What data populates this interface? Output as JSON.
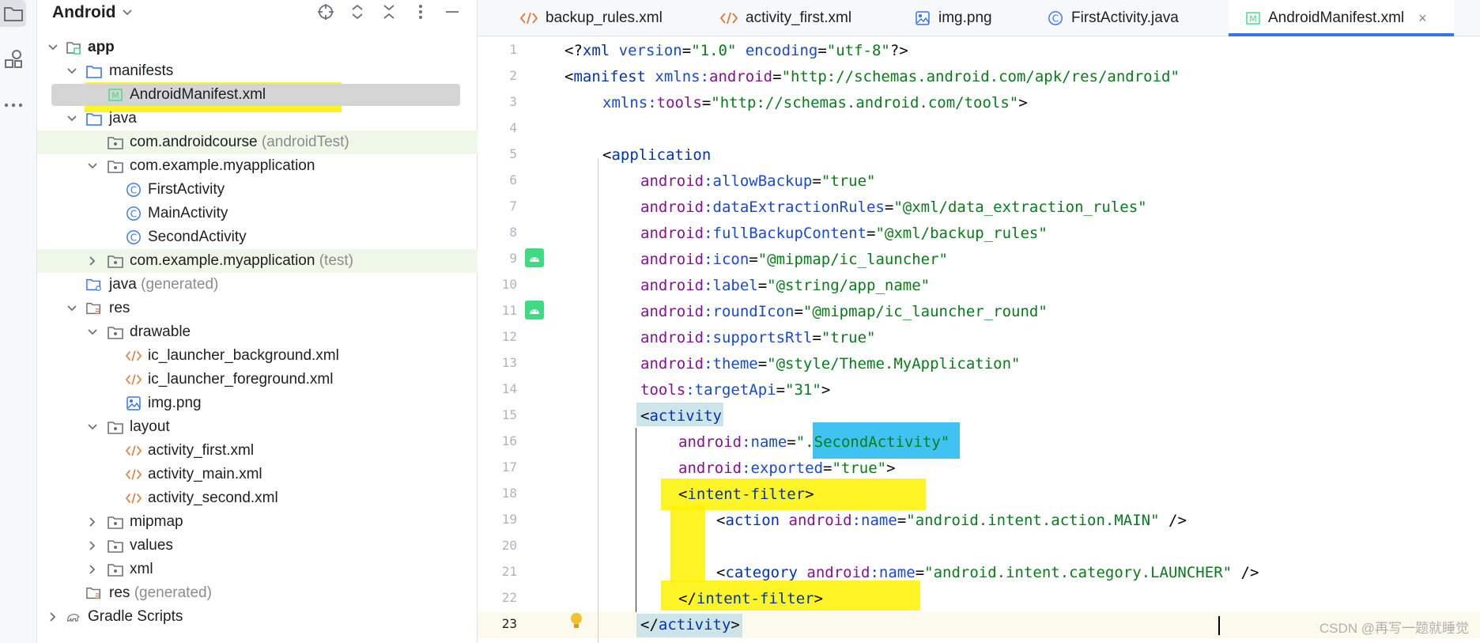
{
  "project_panel": {
    "title": "Android"
  },
  "tree": [
    {
      "label": "app",
      "suffix": "",
      "bold": true
    },
    {
      "label": "manifests",
      "suffix": ""
    },
    {
      "label": "AndroidManifest.xml",
      "suffix": ""
    },
    {
      "label": "java",
      "suffix": ""
    },
    {
      "label": "com.androidcourse",
      "suffix": "(androidTest)"
    },
    {
      "label": "com.example.myapplication",
      "suffix": ""
    },
    {
      "label": "FirstActivity",
      "suffix": ""
    },
    {
      "label": "MainActivity",
      "suffix": ""
    },
    {
      "label": "SecondActivity",
      "suffix": ""
    },
    {
      "label": "com.example.myapplication",
      "suffix": "(test)"
    },
    {
      "label": "java",
      "suffix": "(generated)"
    },
    {
      "label": "res",
      "suffix": ""
    },
    {
      "label": "drawable",
      "suffix": ""
    },
    {
      "label": "ic_launcher_background.xml",
      "suffix": ""
    },
    {
      "label": "ic_launcher_foreground.xml",
      "suffix": ""
    },
    {
      "label": "img.png",
      "suffix": ""
    },
    {
      "label": "layout",
      "suffix": ""
    },
    {
      "label": "activity_first.xml",
      "suffix": ""
    },
    {
      "label": "activity_main.xml",
      "suffix": ""
    },
    {
      "label": "activity_second.xml",
      "suffix": ""
    },
    {
      "label": "mipmap",
      "suffix": ""
    },
    {
      "label": "values",
      "suffix": ""
    },
    {
      "label": "xml",
      "suffix": ""
    },
    {
      "label": "res",
      "suffix": "(generated)"
    },
    {
      "label": "Gradle Scripts",
      "suffix": ""
    }
  ],
  "tabs": [
    {
      "label": "backup_rules.xml"
    },
    {
      "label": "activity_first.xml"
    },
    {
      "label": "img.png"
    },
    {
      "label": "FirstActivity.java"
    },
    {
      "label": "AndroidManifest.xml",
      "close": "×"
    }
  ],
  "line_numbers": [
    "1",
    "2",
    "3",
    "4",
    "5",
    "6",
    "7",
    "8",
    "9",
    "10",
    "11",
    "12",
    "13",
    "14",
    "15",
    "16",
    "17",
    "18",
    "19",
    "20",
    "21",
    "22",
    "23"
  ],
  "code": {
    "l1": {
      "a": "<?",
      "b": "xml",
      "c": " version",
      "d": "=",
      "e": "\"1.0\"",
      "f": " encoding",
      "g": "=",
      "h": "\"utf-8\"",
      "i": "?>"
    },
    "l2": {
      "a": "<",
      "b": "manifest",
      "c": " xmlns:",
      "d": "android",
      "e": "=",
      "f": "\"http://schemas.android.com/apk/res/android\""
    },
    "l3": {
      "a": "xmlns:",
      "b": "tools",
      "c": "=",
      "d": "\"http://schemas.android.com/tools\"",
      "e": ">"
    },
    "l5": {
      "a": "<",
      "b": "application"
    },
    "l6": {
      "ns": "android",
      "attr": ":allowBackup",
      "eq": "=",
      "val": "\"true\""
    },
    "l7": {
      "ns": "android",
      "attr": ":dataExtractionRules",
      "eq": "=",
      "val": "\"@xml/data_extraction_rules\""
    },
    "l8": {
      "ns": "android",
      "attr": ":fullBackupContent",
      "eq": "=",
      "val": "\"@xml/backup_rules\""
    },
    "l9": {
      "ns": "android",
      "attr": ":icon",
      "eq": "=",
      "val": "\"@mipmap/ic_launcher\""
    },
    "l10": {
      "ns": "android",
      "attr": ":label",
      "eq": "=",
      "val": "\"@string/app_name\""
    },
    "l11": {
      "ns": "android",
      "attr": ":roundIcon",
      "eq": "=",
      "val": "\"@mipmap/ic_launcher_round\""
    },
    "l12": {
      "ns": "android",
      "attr": ":supportsRtl",
      "eq": "=",
      "val": "\"true\""
    },
    "l13": {
      "ns": "android",
      "attr": ":theme",
      "eq": "=",
      "val": "\"@style/Theme.MyApplication\""
    },
    "l14": {
      "ns": "tools",
      "attr": ":targetApi",
      "eq": "=",
      "val": "\"31\"",
      "end": ">"
    },
    "l15": {
      "a": "<",
      "b": "activity"
    },
    "l16": {
      "ns": "android",
      "attr": ":name",
      "eq": "=",
      "q1": "\".",
      "val": "SecondActivity",
      "q2": "\""
    },
    "l17": {
      "ns": "android",
      "attr": ":exported",
      "eq": "=",
      "val": "\"true\"",
      "end": ">"
    },
    "l18": {
      "a": "<",
      "b": "intent-filter",
      "c": ">"
    },
    "l19": {
      "a": "<",
      "b": "action",
      "ns": " android",
      "attr": ":name",
      "eq": "=",
      "val": "\"android.intent.action.MAIN\"",
      "end": " />"
    },
    "l21": {
      "a": "<",
      "b": "category",
      "ns": " android",
      "attr": ":name",
      "eq": "=",
      "val": "\"android.intent.category.LAUNCHER\"",
      "end": " />"
    },
    "l22": {
      "a": "</",
      "b": "intent-filter",
      "c": ">"
    },
    "l23": {
      "a": "</",
      "b": "activity",
      "c": ">"
    }
  },
  "watermark": "CSDN @再写一题就睡觉",
  "colors": {
    "highlight_yellow": "#fff200",
    "highlight_blue": "#1fb8f0",
    "tab_accent": "#3574f0",
    "android_green": "#3ddc84"
  }
}
